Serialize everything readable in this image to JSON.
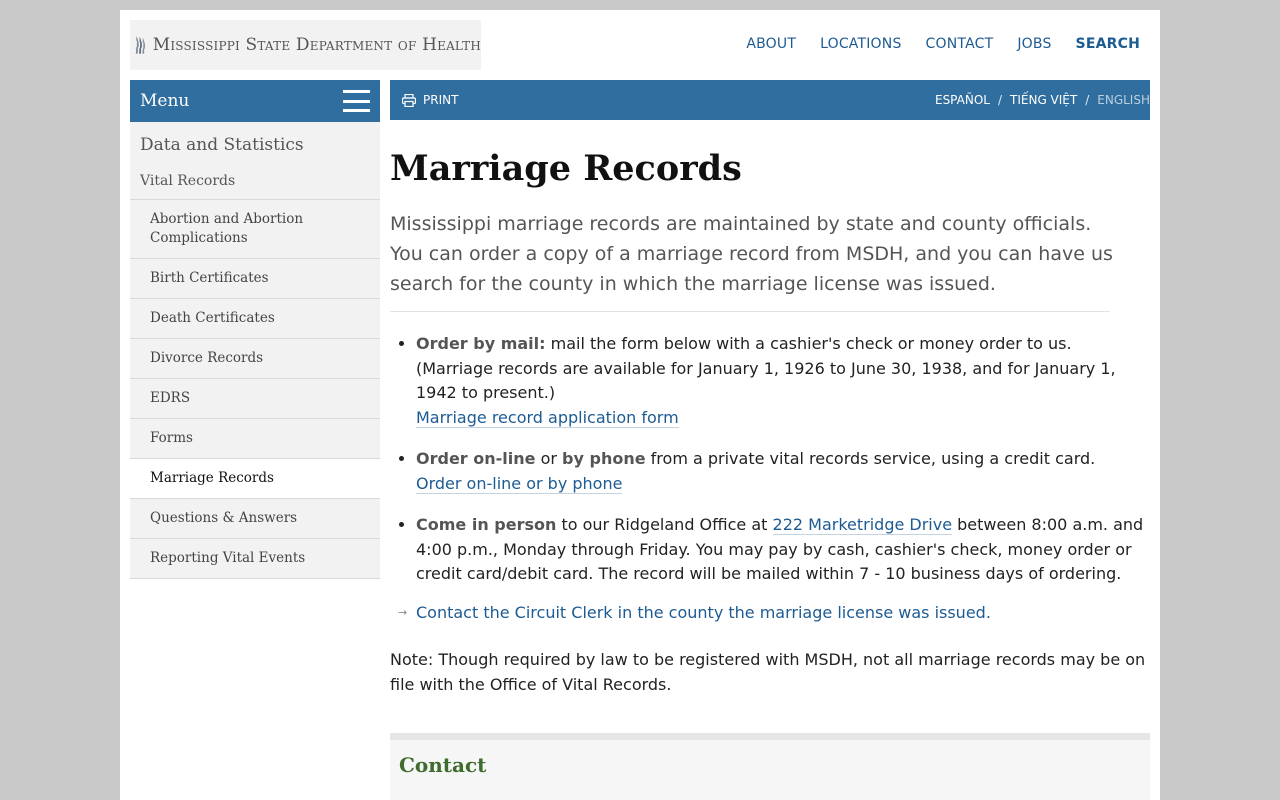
{
  "header": {
    "logo_text": "Mississippi State Department of Health",
    "nav": [
      "ABOUT",
      "LOCATIONS",
      "CONTACT",
      "JOBS",
      "SEARCH"
    ]
  },
  "sidebar": {
    "menu_label": "Menu",
    "category": "Data and Statistics",
    "subcategory": "Vital Records",
    "items": [
      {
        "label": "Abortion and Abortion Complications"
      },
      {
        "label": "Birth Certificates"
      },
      {
        "label": "Death Certificates"
      },
      {
        "label": "Divorce Records"
      },
      {
        "label": "EDRS"
      },
      {
        "label": "Forms"
      },
      {
        "label": "Marriage Records"
      },
      {
        "label": "Questions & Answers"
      },
      {
        "label": "Reporting Vital Events"
      }
    ]
  },
  "toolbar": {
    "print_label": "PRINT",
    "languages": [
      "ESPAÑOL",
      "TIẾNG VIỆT",
      "ENGLISH"
    ],
    "separator": "/"
  },
  "main": {
    "title": "Marriage Records",
    "lead": "Mississippi marriage records are maintained by state and county officials. You can order a copy of a marriage record from MSDH, and you can have us search for the county in which the marriage license was issued.",
    "mail": {
      "bold": "Order by mail:",
      "text": " mail the form below with a cashier's check or money order to us. (Marriage records are available for January 1, 1926 to June 30, 1938, and for January 1, 1942 to present.)",
      "link": "Marriage record application form"
    },
    "online": {
      "bold1": "Order on-line",
      "or": " or ",
      "bold2": "by phone",
      "text": " from a private vital records service, using a credit card.",
      "link": "Order on-line or by phone"
    },
    "in_person": {
      "bold": "Come in person",
      "text1": " to our Ridgeland Office at ",
      "link": "222 Marketridge Drive",
      "text2": " between 8:00 a.m. and 4:00 p.m., Monday through Friday. You may pay by cash, cashier's check, money order or credit card/debit card. The record will be mailed within 7 - 10 business days of ordering."
    },
    "circuit_clerk_link": "Contact the Circuit Clerk in the county the marriage license was issued.",
    "note": "Note: Though required by law to be registered with MSDH, not all marriage records may be on file with the Office of Vital Records.",
    "contact_heading": "Contact"
  },
  "colors": {
    "brand_blue": "#2f6e9e",
    "link_blue": "#1d5b93",
    "contact_green": "#3f6c2e"
  },
  "icons": {
    "logo": "mississippi-figures-logo",
    "menu": "hamburger-icon",
    "print": "printer-icon",
    "bullet_arrow": "arrow-right-icon"
  }
}
